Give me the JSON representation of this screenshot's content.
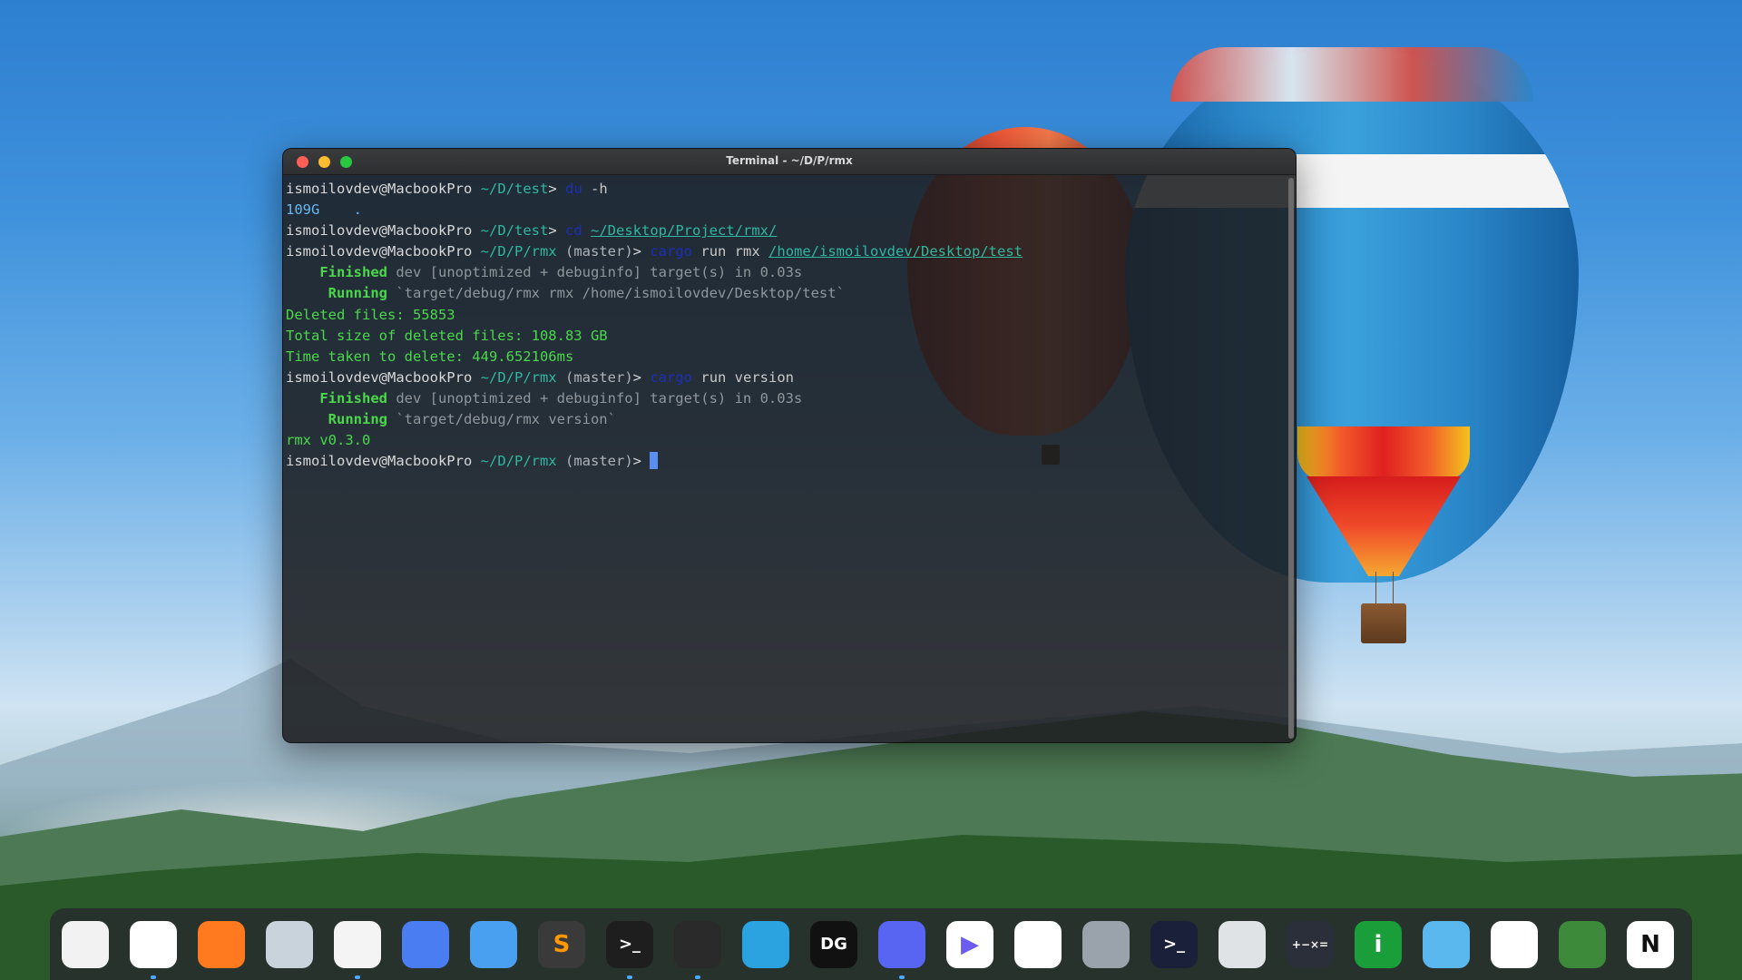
{
  "window": {
    "title": "Terminal - ~/D/P/rmx"
  },
  "terminal": {
    "l1": {
      "user": "ismoilovdev@MacbookPro",
      "path": "~/D/test",
      "prompt": ">",
      "cmd": "du",
      "args": "-h"
    },
    "l2": {
      "out1": "109G",
      "out2": "."
    },
    "l3": {
      "user": "ismoilovdev@MacbookPro",
      "path": "~/D/test",
      "prompt": ">",
      "cmd": "cd",
      "target": "~/Desktop/Project/rmx/"
    },
    "l4": {
      "user": "ismoilovdev@MacbookPro",
      "path": "~/D/P/rmx",
      "branch": "(master)",
      "prompt": ">",
      "cmd": "cargo",
      "args": "run rmx",
      "target": "/home/ismoilovdev/Desktop/test"
    },
    "l5": {
      "keyword": "Finished",
      "text": "dev [unoptimized + debuginfo] target(s) in 0.03s"
    },
    "l6": {
      "keyword": "Running",
      "text": "`target/debug/rmx rmx /home/ismoilovdev/Desktop/test`"
    },
    "l7": {
      "text": "Deleted files: 55853"
    },
    "l8": {
      "text": "Total size of deleted files: 108.83 GB"
    },
    "l9": {
      "text": "Time taken to delete: 449.652106ms"
    },
    "l10": {
      "user": "ismoilovdev@MacbookPro",
      "path": "~/D/P/rmx",
      "branch": "(master)",
      "prompt": ">",
      "cmd": "cargo",
      "args": "run version"
    },
    "l11": {
      "keyword": "Finished",
      "text": "dev [unoptimized + debuginfo] target(s) in 0.03s"
    },
    "l12": {
      "keyword": "Running",
      "text": "`target/debug/rmx version`"
    },
    "l13": {
      "text": "rmx v0.3.0"
    },
    "l14": {
      "user": "ismoilovdev@MacbookPro",
      "path": "~/D/P/rmx",
      "branch": "(master)",
      "prompt": ">"
    }
  },
  "dock": {
    "items": [
      {
        "name": "launchpad",
        "glyph": "",
        "bg": "#f2f2f2",
        "fg": "#333333",
        "running": false
      },
      {
        "name": "chrome",
        "glyph": "",
        "bg": "#ffffff",
        "fg": "#333333",
        "running": true
      },
      {
        "name": "firefox",
        "glyph": "",
        "bg": "#ff7a1f",
        "fg": "#ffffff",
        "running": false
      },
      {
        "name": "screenshot",
        "glyph": "",
        "bg": "#c9d3dc",
        "fg": "#333333",
        "running": false
      },
      {
        "name": "text-editor",
        "glyph": "",
        "bg": "#f4f4f4",
        "fg": "#333333",
        "running": true
      },
      {
        "name": "zoom",
        "glyph": "",
        "bg": "#4a7cf2",
        "fg": "#ffffff",
        "running": false
      },
      {
        "name": "finder",
        "glyph": "",
        "bg": "#4aa0f0",
        "fg": "#ffffff",
        "running": false
      },
      {
        "name": "sublime-text",
        "glyph": "S",
        "bg": "#3a3a3a",
        "fg": "#ff9800",
        "running": false
      },
      {
        "name": "terminal",
        "glyph": ">_",
        "bg": "#1e1e1e",
        "fg": "#ffffff",
        "running": true
      },
      {
        "name": "vscode",
        "glyph": "",
        "bg": "#2a2a2a",
        "fg": "#2fa3ef",
        "running": true
      },
      {
        "name": "telegram",
        "glyph": "",
        "bg": "#2aa3e0",
        "fg": "#ffffff",
        "running": false
      },
      {
        "name": "datagrip",
        "glyph": "DG",
        "bg": "#111111",
        "fg": "#ffffff",
        "running": false
      },
      {
        "name": "discord",
        "glyph": "",
        "bg": "#5865f2",
        "fg": "#ffffff",
        "running": true
      },
      {
        "name": "media-player",
        "glyph": "▶",
        "bg": "#ffffff",
        "fg": "#6a5cf0",
        "running": false
      },
      {
        "name": "photos",
        "glyph": "",
        "bg": "#ffffff",
        "fg": "#333333",
        "running": false
      },
      {
        "name": "disk-utility",
        "glyph": "",
        "bg": "#9aa3ab",
        "fg": "#333333",
        "running": false
      },
      {
        "name": "shell-app",
        "glyph": ">_",
        "bg": "#1a1f3a",
        "fg": "#ffffff",
        "running": false
      },
      {
        "name": "trash",
        "glyph": "",
        "bg": "#dfe3e6",
        "fg": "#333333",
        "running": false
      },
      {
        "name": "calculator",
        "glyph": "+−×=",
        "bg": "#2a2f3a",
        "fg": "#ffffff",
        "running": false
      },
      {
        "name": "system-info",
        "glyph": "i",
        "bg": "#1a9e3a",
        "fg": "#ffffff",
        "running": false
      },
      {
        "name": "network-app",
        "glyph": "",
        "bg": "#5ab8ee",
        "fg": "#ffffff",
        "running": false
      },
      {
        "name": "edge",
        "glyph": "",
        "bg": "#ffffff",
        "fg": "#1a7ad8",
        "running": false
      },
      {
        "name": "android-studio",
        "glyph": "",
        "bg": "#3c8a3a",
        "fg": "#ffffff",
        "running": false
      },
      {
        "name": "notion",
        "glyph": "N",
        "bg": "#ffffff",
        "fg": "#111111",
        "running": false
      }
    ]
  }
}
